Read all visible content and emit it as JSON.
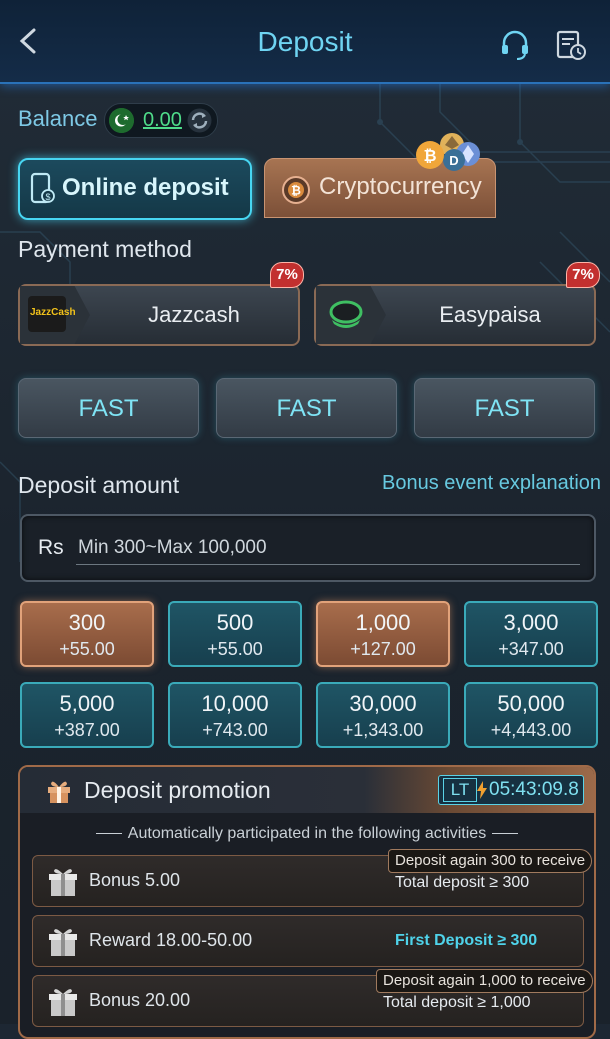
{
  "header": {
    "title": "Deposit"
  },
  "balance": {
    "label": "Balance",
    "value": "0.00"
  },
  "tabs": {
    "online": "Online deposit",
    "crypto": "Cryptocurrency"
  },
  "payment": {
    "label": "Payment method",
    "methods": [
      {
        "name": "Jazzcash",
        "logo_text": "JazzCash",
        "badge": "7%"
      },
      {
        "name": "Easypaisa",
        "badge": "7%"
      }
    ],
    "channels": [
      "FAST",
      "FAST",
      "FAST"
    ]
  },
  "deposit": {
    "label": "Deposit amount",
    "bonus_link": "Bonus event explanation",
    "currency": "Rs",
    "placeholder": "Min 300~Max 100,000",
    "amounts": [
      {
        "value": "300",
        "bonus": "+55.00",
        "style": "copper"
      },
      {
        "value": "500",
        "bonus": "+55.00",
        "style": "teal"
      },
      {
        "value": "1,000",
        "bonus": "+127.00",
        "style": "copper"
      },
      {
        "value": "3,000",
        "bonus": "+347.00",
        "style": "teal"
      },
      {
        "value": "5,000",
        "bonus": "+387.00",
        "style": "teal"
      },
      {
        "value": "10,000",
        "bonus": "+743.00",
        "style": "teal"
      },
      {
        "value": "30,000",
        "bonus": "+1,343.00",
        "style": "teal"
      },
      {
        "value": "50,000",
        "bonus": "+4,443.00",
        "style": "teal"
      }
    ]
  },
  "promotion": {
    "title": "Deposit promotion",
    "timer_prefix": "LT",
    "timer": "05:43:09.8",
    "subtitle": "Automatically participated in the following activities",
    "rows": [
      {
        "label": "Bonus 5.00",
        "tip": "Deposit again 300 to receive",
        "total": "Total deposit ≥ 300"
      },
      {
        "label": "Reward 18.00-50.00",
        "first": "First Deposit ≥ 300"
      },
      {
        "label": "Bonus 20.00",
        "tip": "Deposit again 1,000 to receive",
        "total": "Total deposit ≥ 1,000"
      }
    ]
  },
  "colors": {
    "accent": "#47d6f2",
    "copper": "#a86d4c",
    "badge": "#c2302f"
  }
}
